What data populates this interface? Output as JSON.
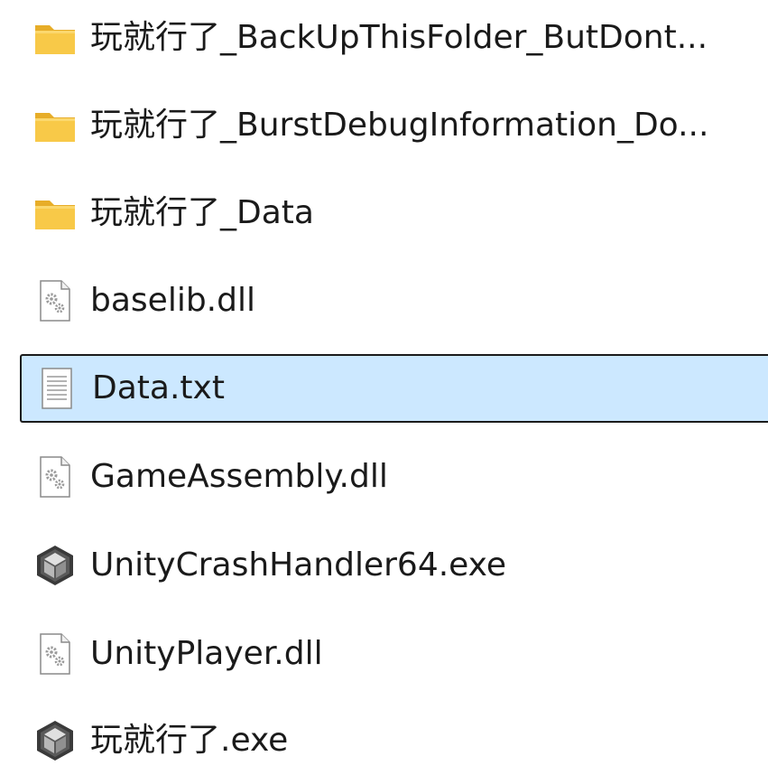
{
  "colors": {
    "folder": "#f8c948",
    "folder_tab": "#e7ad28",
    "selection_bg": "#cce8ff",
    "selection_border": "#1b1b1b",
    "text": "#1a1a1a"
  },
  "files": [
    {
      "name": "玩就行了_BackUpThisFolder_ButDont...",
      "icon": "folder-icon",
      "selected": false
    },
    {
      "name": "玩就行了_BurstDebugInformation_Do...",
      "icon": "folder-icon",
      "selected": false
    },
    {
      "name": "玩就行了_Data",
      "icon": "folder-icon",
      "selected": false
    },
    {
      "name": "baselib.dll",
      "icon": "dll-file-icon",
      "selected": false
    },
    {
      "name": "Data.txt",
      "icon": "text-file-icon",
      "selected": true
    },
    {
      "name": "GameAssembly.dll",
      "icon": "dll-file-icon",
      "selected": false
    },
    {
      "name": "UnityCrashHandler64.exe",
      "icon": "unity-app-icon",
      "selected": false
    },
    {
      "name": "UnityPlayer.dll",
      "icon": "dll-file-icon",
      "selected": false
    },
    {
      "name": "玩就行了.exe",
      "icon": "unity-app-icon",
      "selected": false
    }
  ]
}
